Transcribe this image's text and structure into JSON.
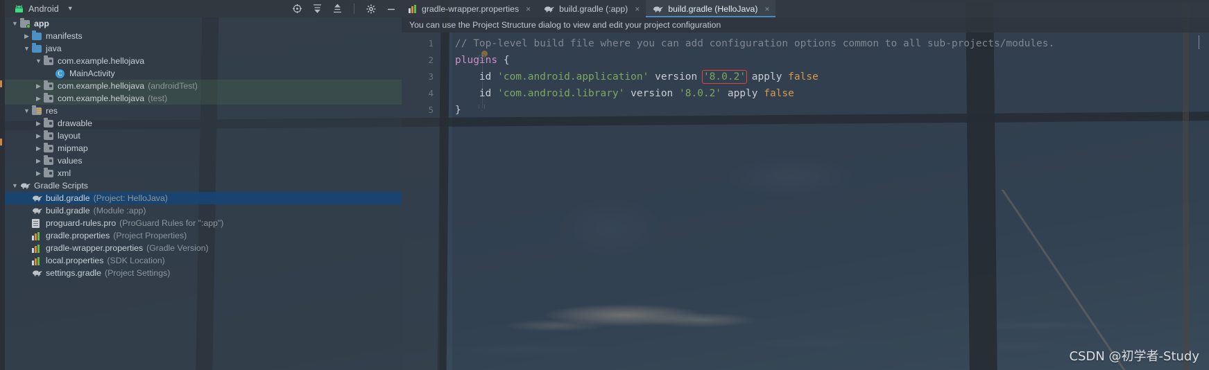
{
  "project_panel": {
    "title": "Android",
    "dropdown_icon": "chevron-down-icon",
    "toolbar_icons": [
      "target-icon",
      "expand-all-icon",
      "collapse-all-icon",
      "settings-icon",
      "minimize-icon"
    ],
    "tree": [
      {
        "depth": 0,
        "arrow": "down",
        "icon": "module-folder-icon",
        "label": "app",
        "hint": "",
        "bold": true,
        "selected": false,
        "tinted": false
      },
      {
        "depth": 1,
        "arrow": "right",
        "icon": "folder-icon",
        "label": "manifests",
        "hint": "",
        "bold": false,
        "selected": false,
        "tinted": false
      },
      {
        "depth": 1,
        "arrow": "down",
        "icon": "folder-icon",
        "label": "java",
        "hint": "",
        "bold": false,
        "selected": false,
        "tinted": false
      },
      {
        "depth": 2,
        "arrow": "down",
        "icon": "package-icon",
        "label": "com.example.hellojava",
        "hint": "",
        "bold": false,
        "selected": false,
        "tinted": false
      },
      {
        "depth": 3,
        "arrow": "none",
        "icon": "java-class-icon",
        "label": "MainActivity",
        "hint": "",
        "bold": false,
        "selected": false,
        "tinted": false
      },
      {
        "depth": 2,
        "arrow": "right",
        "icon": "package-icon",
        "label": "com.example.hellojava",
        "hint": "(androidTest)",
        "bold": false,
        "selected": false,
        "tinted": true
      },
      {
        "depth": 2,
        "arrow": "right",
        "icon": "package-icon",
        "label": "com.example.hellojava",
        "hint": "(test)",
        "bold": false,
        "selected": false,
        "tinted": true
      },
      {
        "depth": 1,
        "arrow": "down",
        "icon": "res-folder-icon",
        "label": "res",
        "hint": "",
        "bold": false,
        "selected": false,
        "tinted": false
      },
      {
        "depth": 2,
        "arrow": "right",
        "icon": "package-icon",
        "label": "drawable",
        "hint": "",
        "bold": false,
        "selected": false,
        "tinted": false
      },
      {
        "depth": 2,
        "arrow": "right",
        "icon": "package-icon",
        "label": "layout",
        "hint": "",
        "bold": false,
        "selected": false,
        "tinted": false
      },
      {
        "depth": 2,
        "arrow": "right",
        "icon": "package-icon",
        "label": "mipmap",
        "hint": "",
        "bold": false,
        "selected": false,
        "tinted": false
      },
      {
        "depth": 2,
        "arrow": "right",
        "icon": "package-icon",
        "label": "values",
        "hint": "",
        "bold": false,
        "selected": false,
        "tinted": false
      },
      {
        "depth": 2,
        "arrow": "right",
        "icon": "package-icon",
        "label": "xml",
        "hint": "",
        "bold": false,
        "selected": false,
        "tinted": false
      },
      {
        "depth": 0,
        "arrow": "down",
        "icon": "gradle-elephant-icon",
        "label": "Gradle Scripts",
        "hint": "",
        "bold": false,
        "selected": false,
        "tinted": false
      },
      {
        "depth": 1,
        "arrow": "none",
        "icon": "gradle-elephant-icon",
        "label": "build.gradle",
        "hint": "(Project: HelloJava)",
        "bold": false,
        "selected": true,
        "tinted": false
      },
      {
        "depth": 1,
        "arrow": "none",
        "icon": "gradle-elephant-icon",
        "label": "build.gradle",
        "hint": "(Module :app)",
        "bold": false,
        "selected": false,
        "tinted": false
      },
      {
        "depth": 1,
        "arrow": "none",
        "icon": "document-icon",
        "label": "proguard-rules.pro",
        "hint": "(ProGuard Rules for \":app\")",
        "bold": false,
        "selected": false,
        "tinted": false
      },
      {
        "depth": 1,
        "arrow": "none",
        "icon": "properties-icon",
        "label": "gradle.properties",
        "hint": "(Project Properties)",
        "bold": false,
        "selected": false,
        "tinted": false
      },
      {
        "depth": 1,
        "arrow": "none",
        "icon": "properties-icon",
        "label": "gradle-wrapper.properties",
        "hint": "(Gradle Version)",
        "bold": false,
        "selected": false,
        "tinted": false
      },
      {
        "depth": 1,
        "arrow": "none",
        "icon": "properties-icon",
        "label": "local.properties",
        "hint": "(SDK Location)",
        "bold": false,
        "selected": false,
        "tinted": false
      },
      {
        "depth": 1,
        "arrow": "none",
        "icon": "gradle-elephant-icon",
        "label": "settings.gradle",
        "hint": "(Project Settings)",
        "bold": false,
        "selected": false,
        "tinted": false
      }
    ]
  },
  "editor": {
    "tabs": [
      {
        "icon": "properties-icon",
        "label": "gradle-wrapper.properties",
        "active": false,
        "closable": true
      },
      {
        "icon": "gradle-elephant-icon",
        "label": "build.gradle (:app)",
        "active": false,
        "closable": true
      },
      {
        "icon": "gradle-elephant-icon",
        "label": "build.gradle (HelloJava)",
        "active": true,
        "closable": true
      }
    ],
    "close_glyph": "×",
    "notification": "You can use the Project Structure dialog to view and edit your project configuration",
    "line_numbers": [
      "1",
      "2",
      "3",
      "4",
      "5"
    ],
    "code_lines": [
      {
        "n": "1",
        "tokens": [
          {
            "t": "// Top-level build file where you can add configuration options common to all sub-projects/modules.",
            "c": "comment"
          }
        ]
      },
      {
        "n": "2",
        "tokens": [
          {
            "t": "plugins",
            "c": "kw"
          },
          {
            "t": " {",
            "c": "brace"
          }
        ]
      },
      {
        "n": "3",
        "tokens": [
          {
            "t": "    id ",
            "c": "plain"
          },
          {
            "t": "'com.android.application'",
            "c": "str"
          },
          {
            "t": " version ",
            "c": "plain"
          },
          {
            "t": "'8.0.2'",
            "c": "str",
            "error_box": true
          },
          {
            "t": " apply ",
            "c": "plain"
          },
          {
            "t": "false",
            "c": "num"
          }
        ]
      },
      {
        "n": "4",
        "tokens": [
          {
            "t": "    id ",
            "c": "plain"
          },
          {
            "t": "'com.android.library'",
            "c": "str"
          },
          {
            "t": " version ",
            "c": "plain"
          },
          {
            "t": "'8.0.2'",
            "c": "str"
          },
          {
            "t": " apply ",
            "c": "plain"
          },
          {
            "t": "false",
            "c": "num"
          }
        ]
      },
      {
        "n": "5",
        "tokens": [
          {
            "t": "}",
            "c": "brace"
          }
        ]
      }
    ]
  },
  "watermark": "CSDN @初学者-Study",
  "colors": {
    "accent_tab_underline": "#4a88c7",
    "selection_blue": "#174474",
    "error_outline": "#e04343",
    "string_green": "#7fa85f",
    "keyword_purple": "#cf8ec8",
    "number_orange": "#d79a4a",
    "comment_gray": "#7f878f"
  }
}
